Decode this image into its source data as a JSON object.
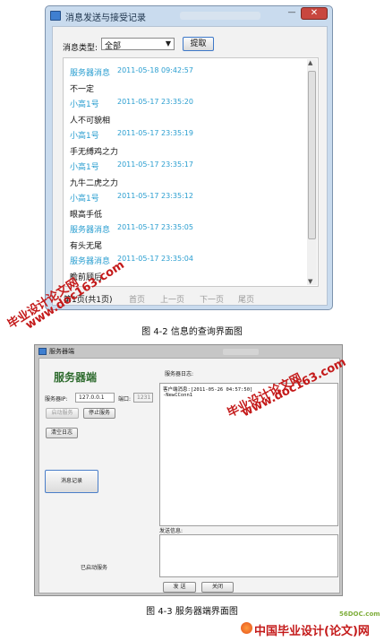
{
  "query_window": {
    "title": "消息发送与接受记录",
    "close_glyph": "✕",
    "min_glyph": "—",
    "filter_label": "消息类型:",
    "filter_value": "全部",
    "fetch_button": "提取",
    "messages": [
      {
        "sender": "服务器消息",
        "time": "2011-05-18 09:42:57",
        "content": "不一定"
      },
      {
        "sender": "小高1号",
        "time": "2011-05-17 23:35:20",
        "content": "人不可貌相"
      },
      {
        "sender": "小高1号",
        "time": "2011-05-17 23:35:19",
        "content": "手无缚鸡之力"
      },
      {
        "sender": "小高1号",
        "time": "2011-05-17 23:35:17",
        "content": "九牛二虎之力"
      },
      {
        "sender": "小高1号",
        "time": "2011-05-17 23:35:12",
        "content": "眼高手低"
      },
      {
        "sender": "服务器消息",
        "time": "2011-05-17 23:35:05",
        "content": "有头无尾"
      },
      {
        "sender": "服务器消息",
        "time": "2011-05-17 23:35:04",
        "content": "瞻前顾后"
      }
    ],
    "pager": {
      "page_info": "第1页(共1页)",
      "first": "首页",
      "prev": "上一页",
      "next": "下一页",
      "last": "尾页"
    }
  },
  "caption1": "图 4-2 信息的查询界面图",
  "server_window": {
    "title": "服务器端",
    "heading": "服务器端",
    "ip_label": "服务器IP:",
    "ip_value": "127.0.0.1",
    "port_label": "端口:",
    "port_value": "1231",
    "start_button": "启动服务",
    "stop_button": "停止服务",
    "clear_button": "清空日志",
    "records_button": "消息记录",
    "log_label": "服务器日志:",
    "log_lines": [
      "客户端消息:[2011-05-26 04:57:50]",
      "-NewCConn1"
    ],
    "send_label": "发送信息:",
    "status": "已启动服务",
    "send_button": "发 送",
    "close_button": "关闭"
  },
  "caption2": "图 4-3 服务器端界面图",
  "watermarks": {
    "site_text": "www.doc163.com",
    "brand_text": "毕业设计论文网",
    "logo_text": "中国毕业设计(论文)网",
    "logo_site": "56DOC.com"
  },
  "colors": {
    "sender_time": "#2a9ed0",
    "watermark": "#c41a1a",
    "server_heading": "#2e6b2e"
  }
}
